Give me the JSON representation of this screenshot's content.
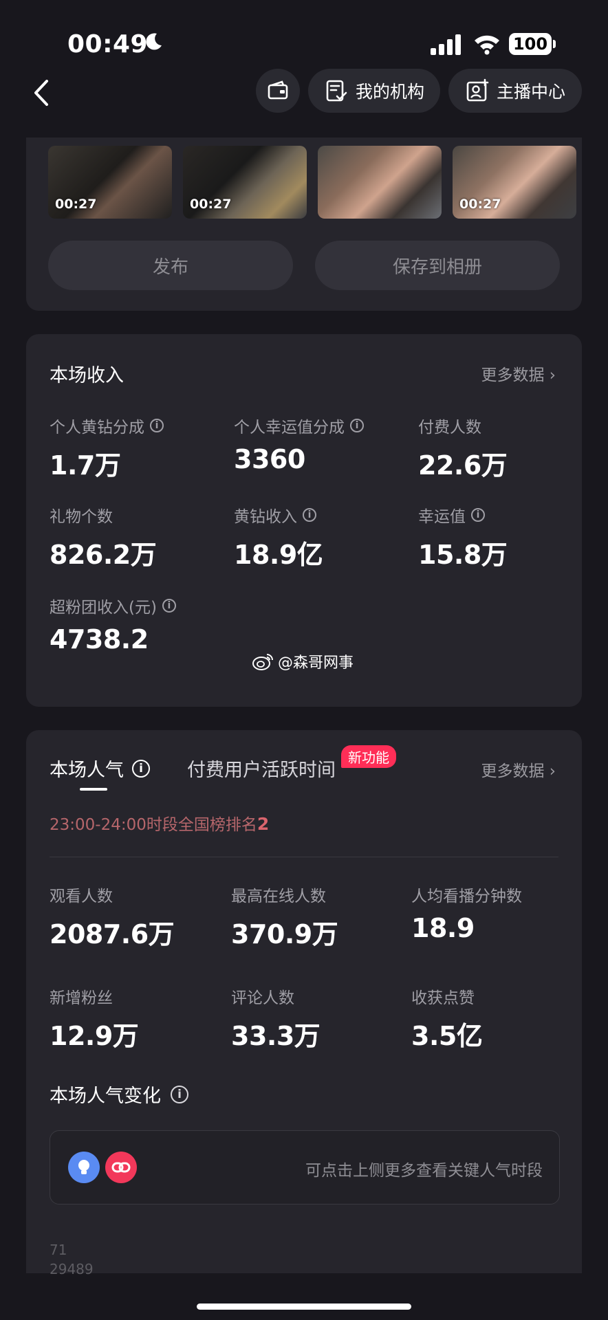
{
  "status_bar": {
    "time": "00:49",
    "battery": "100"
  },
  "nav": {
    "org_label": "我的机构",
    "anchor_label": "主播中心"
  },
  "clips": [
    {
      "duration": "00:27"
    },
    {
      "duration": "00:27"
    },
    {
      "duration": ""
    },
    {
      "duration": "00:27"
    }
  ],
  "actions": {
    "publish": "发布",
    "save": "保存到相册"
  },
  "income": {
    "title": "本场收入",
    "more": "更多数据 ›",
    "stats": [
      {
        "label": "个人黄钻分成",
        "value": "1.7万",
        "info": true
      },
      {
        "label": "个人幸运值分成",
        "value": "3360",
        "info": true
      },
      {
        "label": "付费人数",
        "value": "22.6万",
        "info": false
      },
      {
        "label": "礼物个数",
        "value": "826.2万",
        "info": false
      },
      {
        "label": "黄钻收入",
        "value": "18.9亿",
        "info": true
      },
      {
        "label": "幸运值",
        "value": "15.8万",
        "info": true
      },
      {
        "label": "超粉团收入(元)",
        "value": "4738.2",
        "info": true
      }
    ]
  },
  "watermark": "@森哥网事",
  "popularity": {
    "tab_active": "本场人气",
    "tab_other": "付费用户活跃时间",
    "badge": "新功能",
    "more": "更多数据 ›",
    "rank_prefix": "23:00-24:00时段全国榜排名",
    "rank_value": "2",
    "stats": [
      {
        "label": "观看人数",
        "value": "2087.6万"
      },
      {
        "label": "最高在线人数",
        "value": "370.9万"
      },
      {
        "label": "人均看播分钟数",
        "value": "18.9"
      },
      {
        "label": "新增粉丝",
        "value": "12.9万"
      },
      {
        "label": "评论人数",
        "value": "33.3万"
      },
      {
        "label": "收获点赞",
        "value": "3.5亿"
      }
    ],
    "change_title": "本场人气变化",
    "hint": "可点击上侧更多查看关键人气时段",
    "axis_labels": [
      "71",
      "29489"
    ]
  }
}
